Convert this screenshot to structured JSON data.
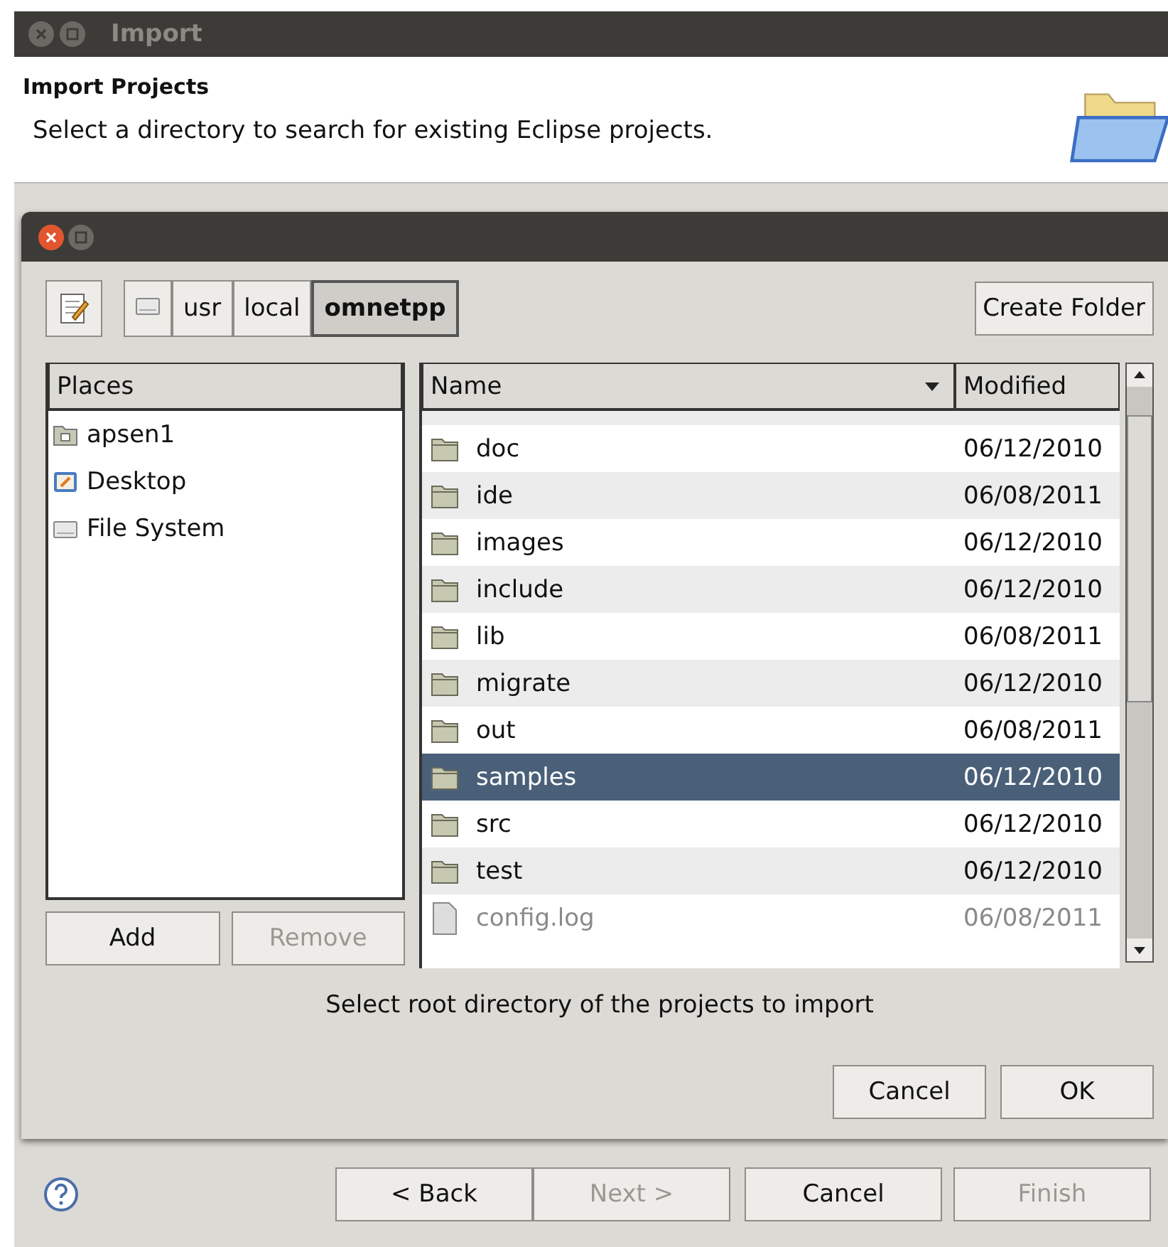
{
  "window": {
    "title": "Import"
  },
  "header": {
    "title": "Import Projects",
    "description": "Select a directory to search for existing Eclipse projects."
  },
  "chooser": {
    "path": [
      {
        "label": "usr",
        "selected": false
      },
      {
        "label": "local",
        "selected": false
      },
      {
        "label": "omnetpp",
        "selected": true
      }
    ],
    "create_folder": "Create Folder",
    "places": {
      "heading": "Places",
      "items": [
        {
          "label": "apsen1",
          "kind": "home"
        },
        {
          "label": "Desktop",
          "kind": "desktop"
        },
        {
          "label": "File System",
          "kind": "drive"
        }
      ]
    },
    "place_buttons": [
      {
        "label": "Add",
        "disabled": false
      },
      {
        "label": "Remove",
        "disabled": true
      }
    ],
    "table": {
      "columns": [
        "Name",
        "Modified"
      ],
      "rows": [
        {
          "name": "doc",
          "modified": "06/12/2010",
          "kind": "folder",
          "selected": false,
          "disabled": false
        },
        {
          "name": "ide",
          "modified": "06/08/2011",
          "kind": "folder",
          "selected": false,
          "disabled": false
        },
        {
          "name": "images",
          "modified": "06/12/2010",
          "kind": "folder",
          "selected": false,
          "disabled": false
        },
        {
          "name": "include",
          "modified": "06/12/2010",
          "kind": "folder",
          "selected": false,
          "disabled": false
        },
        {
          "name": "lib",
          "modified": "06/08/2011",
          "kind": "folder",
          "selected": false,
          "disabled": false
        },
        {
          "name": "migrate",
          "modified": "06/12/2010",
          "kind": "folder",
          "selected": false,
          "disabled": false
        },
        {
          "name": "out",
          "modified": "06/08/2011",
          "kind": "folder",
          "selected": false,
          "disabled": false
        },
        {
          "name": "samples",
          "modified": "06/12/2010",
          "kind": "folder",
          "selected": true,
          "disabled": false
        },
        {
          "name": "src",
          "modified": "06/12/2010",
          "kind": "folder",
          "selected": false,
          "disabled": false
        },
        {
          "name": "test",
          "modified": "06/12/2010",
          "kind": "folder",
          "selected": false,
          "disabled": false
        },
        {
          "name": "config.log",
          "modified": "06/08/2011",
          "kind": "file",
          "selected": false,
          "disabled": true
        }
      ]
    },
    "message": "Select root directory of the projects to import",
    "buttons": [
      {
        "label": "Cancel",
        "disabled": false
      },
      {
        "label": "OK",
        "disabled": false
      }
    ]
  },
  "footer_buttons": [
    {
      "label": "< Back",
      "disabled": false
    },
    {
      "label": "Next >",
      "disabled": true
    },
    {
      "label": "Cancel",
      "disabled": false
    },
    {
      "label": "Finish",
      "disabled": true
    }
  ]
}
